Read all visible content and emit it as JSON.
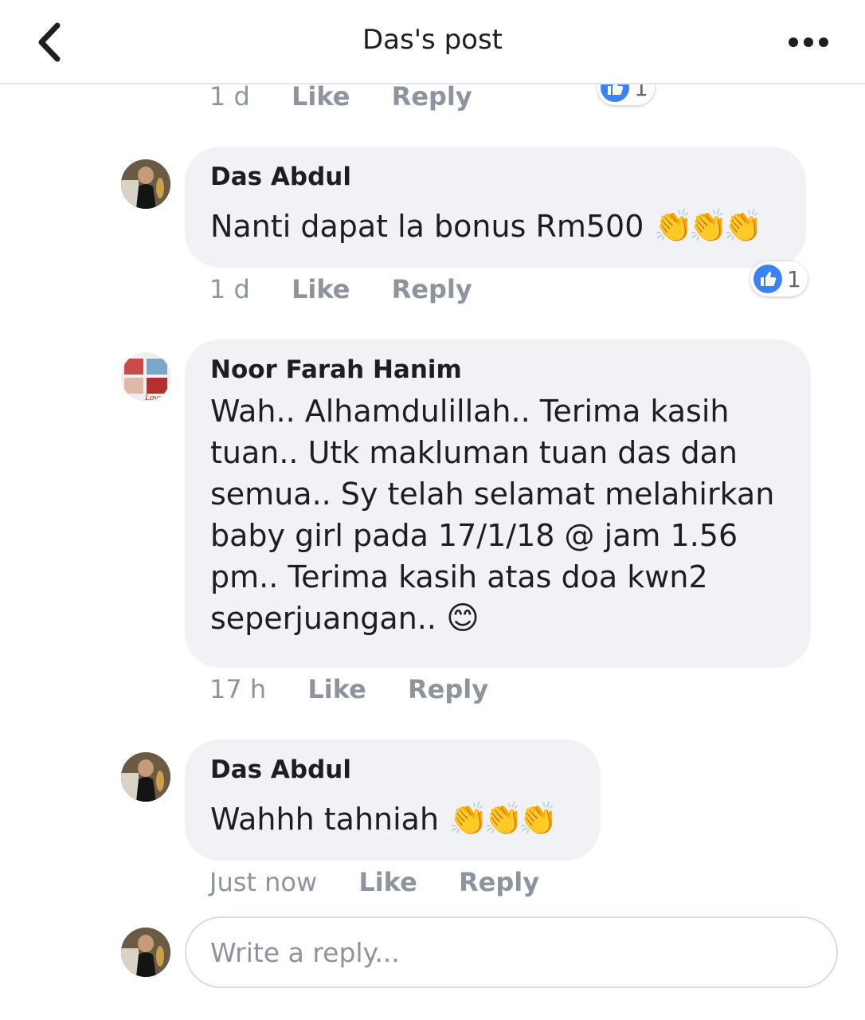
{
  "header": {
    "title": "Das's post",
    "back_icon": "chevron-left-icon",
    "more_icon": "more-dots-icon"
  },
  "colors": {
    "like_blue": "#3b82f6",
    "bubble_bg": "#f0f2f5",
    "meta_gray": "#8d949e"
  },
  "comments": [
    {
      "time": "1 d",
      "like_label": "Like",
      "reply_label": "Reply",
      "reaction_count": "1"
    },
    {
      "author": "Das Abdul",
      "text": "Nanti dapat la bonus Rm500",
      "emoji": "👏👏👏",
      "time": "1 d",
      "like_label": "Like",
      "reply_label": "Reply",
      "reaction_count": "1"
    },
    {
      "author": "Noor Farah Hanim",
      "text": "Wah.. Alhamdulillah.. Terima kasih tuan.. Utk makluman tuan das dan semua.. Sy telah selamat melahirkan baby girl pada 17/1/18 @ jam 1.56 pm.. Terima kasih atas doa kwn2 seperjuangan..",
      "emoji": "😊",
      "time": "17 h",
      "like_label": "Like",
      "reply_label": "Reply"
    },
    {
      "author": "Das Abdul",
      "text": "Wahhh tahniah",
      "emoji": "👏👏👏",
      "time": "Just now",
      "like_label": "Like",
      "reply_label": "Reply"
    }
  ],
  "reply_box": {
    "placeholder": "Write a reply..."
  }
}
